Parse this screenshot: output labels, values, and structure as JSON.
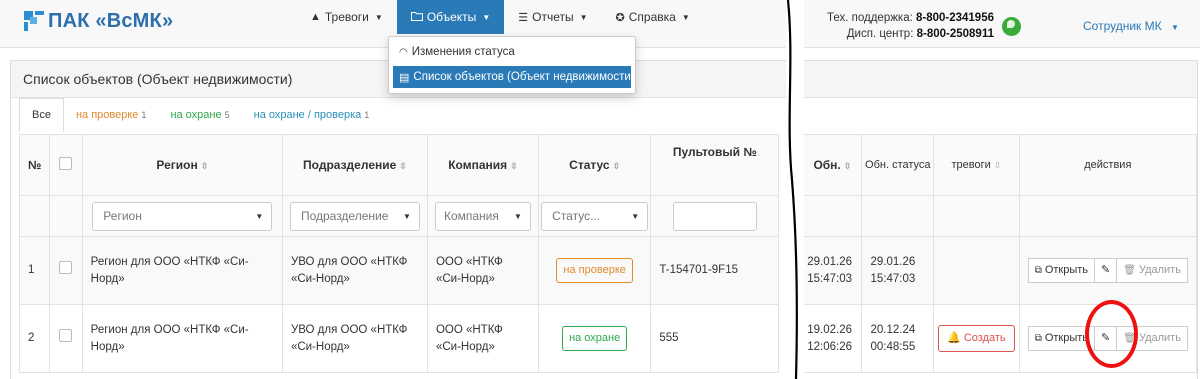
{
  "brand": {
    "name": "ПАК «ВсМК»",
    "accent": "#2a7ab8"
  },
  "nav": [
    {
      "label": "Тревоги",
      "icon": "warning-icon",
      "has_caret": true
    },
    {
      "label": "Объекты",
      "icon": "folder-icon",
      "has_caret": true,
      "active": true
    },
    {
      "label": "Отчеты",
      "icon": "list-icon",
      "has_caret": true
    },
    {
      "label": "Справка",
      "icon": "lifebuoy-icon",
      "has_caret": true
    }
  ],
  "support": {
    "tech_label": "Тех. поддержка:",
    "tech_phone": "8-800-2341956",
    "disp_label": "Дисп. центр:",
    "disp_phone": "8-800-2508911"
  },
  "user": {
    "label": "Сотрудник МК"
  },
  "dropdown": {
    "items": [
      {
        "label": "Изменения статуса",
        "icon": "rss-icon"
      },
      {
        "label": "Список объектов (Объект недвижимости)",
        "icon": "document-icon",
        "active": true
      }
    ]
  },
  "panel": {
    "title": "Список объектов (Объект недвижимости)"
  },
  "tabs": [
    {
      "label": "Все",
      "count": "",
      "color": "#333333",
      "active": true
    },
    {
      "label": "на проверке",
      "count": "1",
      "color": "#e08b2e"
    },
    {
      "label": "на охране",
      "count": "5",
      "color": "#2fa84f"
    },
    {
      "label": "на охране / проверка",
      "count": "1",
      "color": "#2a8fb8"
    }
  ],
  "columns": {
    "num": "№",
    "region": "Регион",
    "division": "Подразделение",
    "company": "Компания",
    "status": "Статус",
    "console": "Пультовый №",
    "updated": "Обн.",
    "status_updated": "Обн. статуса",
    "alarms": "тревоги",
    "actions": "действия"
  },
  "filters": {
    "region": "Регион",
    "division": "Подразделение",
    "company": "Компания",
    "status": "Статус..."
  },
  "rows": [
    {
      "num": "1",
      "region": "Регион для ООО «НТКФ «Си-Норд»",
      "division": "УВО для ООО «НТКФ «Си-Норд»",
      "company": "ООО «НТКФ «Си-Норд»",
      "status": "на проверке",
      "status_kind": "warn",
      "console": "T-154701-9F15",
      "updated_date": "29.01.26",
      "updated_time": "15:47:03",
      "status_date": "29.01.26",
      "status_time": "15:47:03",
      "alarm": ""
    },
    {
      "num": "2",
      "region": "Регион для ООО «НТКФ «Си-Норд»",
      "division": "УВО для ООО «НТКФ «Си-Норд»",
      "company": "ООО «НТКФ «Си-Норд»",
      "status": "на охране",
      "status_kind": "ok",
      "console": "555",
      "updated_date": "19.02.26",
      "updated_time": "12:06:26",
      "status_date": "20.12.24",
      "status_time": "00:48:55",
      "alarm": "Создать"
    }
  ],
  "actions": {
    "open": "Открыть",
    "delete": "Удалить"
  }
}
